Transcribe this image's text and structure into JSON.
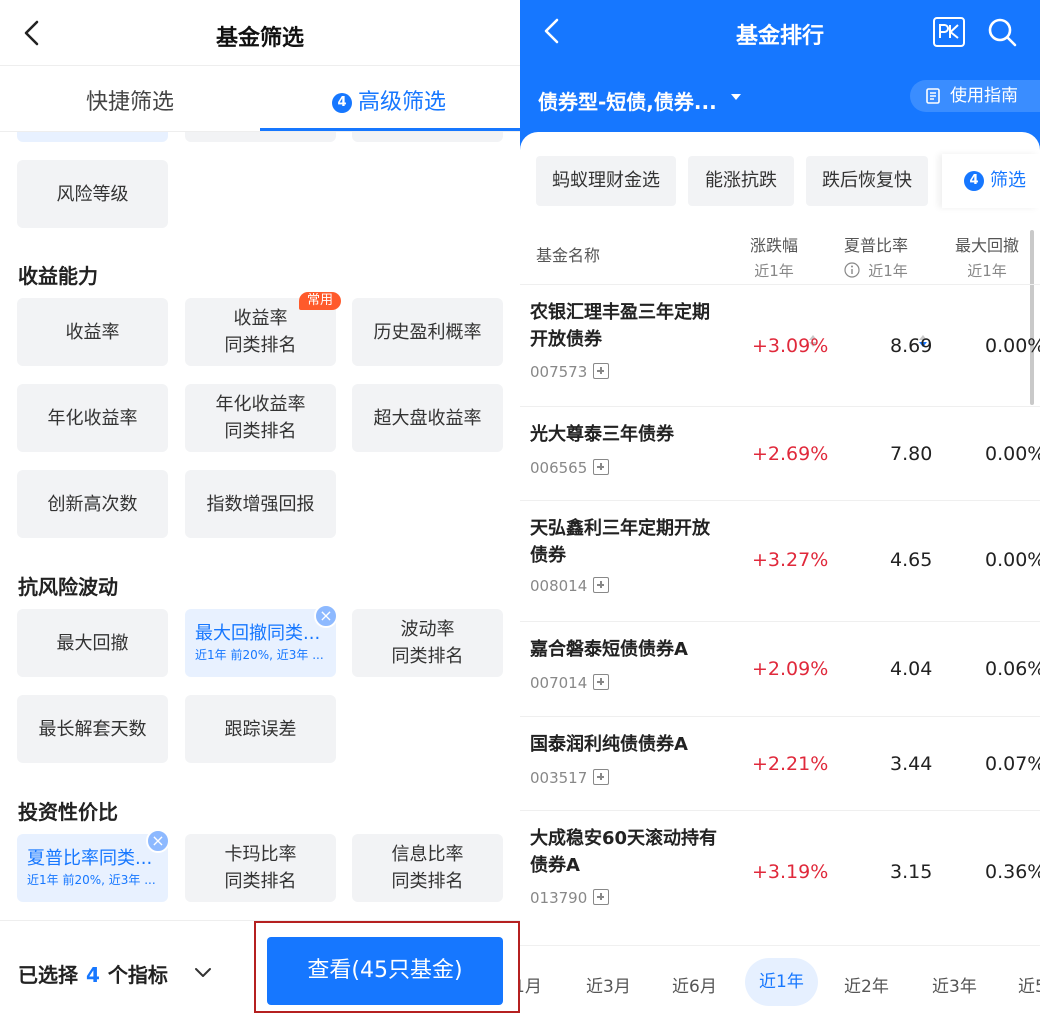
{
  "left": {
    "header": {
      "title": "基金筛选"
    },
    "tabs": [
      {
        "label": "快捷筛选"
      },
      {
        "label": "高级筛选",
        "badge": "4"
      }
    ],
    "top_items": [
      {
        "label": "风险等级"
      }
    ],
    "sections": [
      {
        "title": "收益能力",
        "items": [
          {
            "line1": "收益率"
          },
          {
            "line1": "收益率",
            "line2": "同类排名",
            "tag": "常用"
          },
          {
            "line1": "历史盈利概率"
          },
          {
            "line1": "年化收益率"
          },
          {
            "line1": "年化收益率",
            "line2": "同类排名"
          },
          {
            "line1": "超大盘收益率"
          },
          {
            "line1": "创新高次数"
          },
          {
            "line1": "指数增强回报"
          }
        ]
      },
      {
        "title": "抗风险波动",
        "items": [
          {
            "line1": "最大回撤"
          },
          {
            "line1": "最大回撤同类...",
            "sub": "近1年 前20%, 近3年 ...",
            "selected": true
          },
          {
            "line1": "波动率",
            "line2": "同类排名"
          },
          {
            "line1": "最长解套天数"
          },
          {
            "line1": "跟踪误差"
          }
        ]
      },
      {
        "title": "投资性价比",
        "items": [
          {
            "line1": "夏普比率同类...",
            "sub": "近1年 前20%, 近3年 ...",
            "selected": true
          },
          {
            "line1": "卡玛比率",
            "line2": "同类排名"
          },
          {
            "line1": "信息比率",
            "line2": "同类排名"
          }
        ]
      }
    ],
    "footer": {
      "selected_prefix": "已选择",
      "selected_count": "4",
      "selected_suffix": "个指标",
      "view_button": "查看(45只基金)"
    },
    "remove_glyph": "×"
  },
  "right": {
    "header": {
      "title": "基金排行"
    },
    "category": "债券型-短债,债券...",
    "guide": "使用指南",
    "chips": [
      "蚂蚁理财金选",
      "能涨抗跌",
      "跌后恢复快"
    ],
    "filter_chip": {
      "label": "筛选",
      "badge": "4"
    },
    "columns": {
      "name": "基金名称",
      "change": {
        "label": "涨跌幅",
        "sub": "近1年"
      },
      "sharpe": {
        "label": "夏普比率",
        "sub": "近1年"
      },
      "drawdown": {
        "label": "最大回撤",
        "sub": "近1年"
      }
    },
    "rows": [
      {
        "name": "农银汇理丰盈三年定期开放债券",
        "code": "007573",
        "change": "+3.09%",
        "sharpe": "8.69",
        "drawdown": "0.00%"
      },
      {
        "name": "光大尊泰三年债券",
        "code": "006565",
        "change": "+2.69%",
        "sharpe": "7.80",
        "drawdown": "0.00%"
      },
      {
        "name": "天弘鑫利三年定期开放债券",
        "code": "008014",
        "change": "+3.27%",
        "sharpe": "4.65",
        "drawdown": "0.00%"
      },
      {
        "name": "嘉合磐泰短债债券A",
        "code": "007014",
        "change": "+2.09%",
        "sharpe": "4.04",
        "drawdown": "0.06%"
      },
      {
        "name": "国泰润利纯债债券A",
        "code": "003517",
        "change": "+2.21%",
        "sharpe": "3.44",
        "drawdown": "0.07%"
      },
      {
        "name": "大成稳安60天滚动持有债券A",
        "code": "013790",
        "change": "+3.19%",
        "sharpe": "3.15",
        "drawdown": "0.36%"
      }
    ],
    "periods": [
      "1月",
      "近3月",
      "近6月",
      "近1年",
      "近2年",
      "近3年",
      "近5"
    ],
    "active_period": "近1年"
  },
  "colors": {
    "brand_blue": "#1677ff",
    "up_red": "#e0293b",
    "tag_orange": "#ff5a2b",
    "highlight_box": "#b52020"
  }
}
